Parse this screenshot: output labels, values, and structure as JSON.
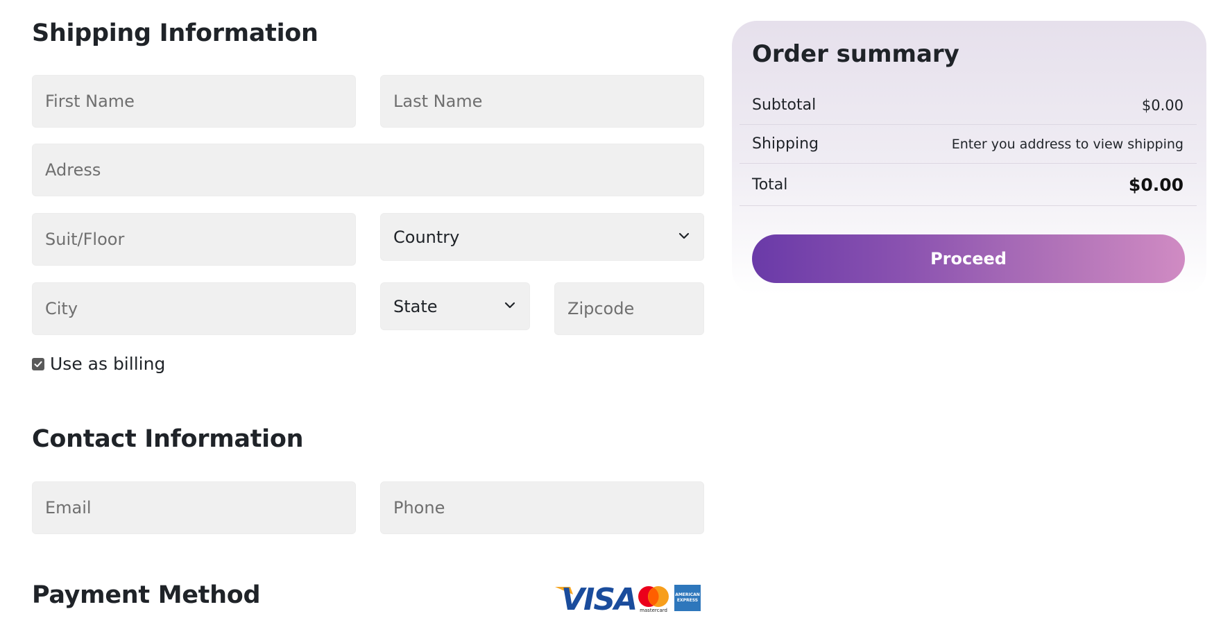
{
  "shipping": {
    "title": "Shipping Information",
    "first_name_placeholder": "First Name",
    "last_name_placeholder": "Last Name",
    "address_placeholder": "Adress",
    "suite_placeholder": "Suit/Floor",
    "country_label": "Country",
    "city_placeholder": "City",
    "state_label": "State",
    "zipcode_placeholder": "Zipcode",
    "use_as_billing_label": "Use as billing",
    "use_as_billing_checked": true
  },
  "contact": {
    "title": "Contact Information",
    "email_placeholder": "Email",
    "phone_placeholder": "Phone"
  },
  "payment": {
    "title": "Payment Method",
    "card_icons": [
      "visa-icon",
      "mastercard-icon",
      "amex-icon"
    ],
    "visa_text": "VISA",
    "mastercard_text": "mastercard",
    "amex_text": "AMERICAN EXPRESS"
  },
  "summary": {
    "title": "Order summary",
    "subtotal_label": "Subtotal",
    "subtotal_value": "$0.00",
    "shipping_label": "Shipping",
    "shipping_value": "Enter you address to view shipping",
    "total_label": "Total",
    "total_value": "$0.00",
    "proceed_label": "Proceed"
  },
  "colors": {
    "field_bg": "#f0f0f0",
    "text": "#1f2328",
    "button_gradient_start": "#6a3aa8",
    "button_gradient_end": "#d08bc3",
    "summary_bg_top": "#e6e0ec",
    "visa_blue": "#1a4c9c",
    "visa_gold": "#f5a623",
    "mastercard_red": "#eb001b",
    "mastercard_orange": "#f79e1b",
    "amex_blue": "#2e77bc"
  }
}
